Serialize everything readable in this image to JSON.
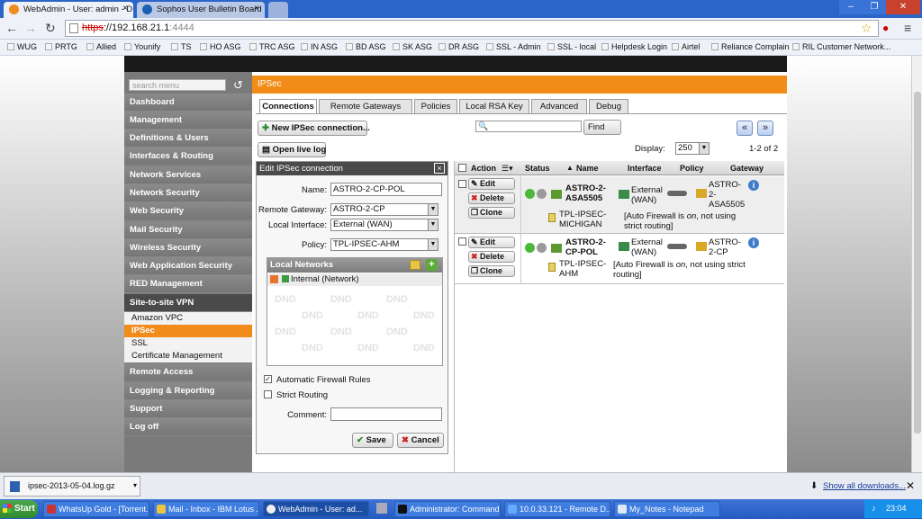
{
  "browser": {
    "tabs": [
      {
        "label": "WebAdmin - User: admin - D"
      },
      {
        "label": "Sophos User Bulletin Board"
      }
    ],
    "address": {
      "scheme": "https",
      "host": "://192.168.21.1",
      "port": ":4444"
    },
    "bookmarks": [
      "WUG",
      "PRTG",
      "Allied",
      "Younify",
      "TS",
      "HO ASG",
      "TRC ASG",
      "IN ASG",
      "BD ASG",
      "SK ASG",
      "DR ASG",
      "SSL - Admin",
      "SSL - local",
      "Helpdesk Login",
      "Airtel",
      "Reliance Complain",
      "RIL Customer Network..."
    ]
  },
  "sidebar": {
    "search_placeholder": "search menu",
    "items": [
      {
        "label": "Dashboard"
      },
      {
        "label": "Management"
      },
      {
        "label": "Definitions & Users"
      },
      {
        "label": "Interfaces & Routing"
      },
      {
        "label": "Network Services"
      },
      {
        "label": "Network Security"
      },
      {
        "label": "Web Security"
      },
      {
        "label": "Mail Security"
      },
      {
        "label": "Wireless Security"
      },
      {
        "label": "Web Application Security"
      },
      {
        "label": "RED Management"
      },
      {
        "label": "Site-to-site VPN"
      }
    ],
    "subitems": [
      {
        "label": "Amazon VPC"
      },
      {
        "label": "IPSec"
      },
      {
        "label": "SSL"
      },
      {
        "label": "Certificate Management"
      }
    ],
    "items_after": [
      {
        "label": "Remote Access"
      },
      {
        "label": "Logging & Reporting"
      },
      {
        "label": "Support"
      },
      {
        "label": "Log off"
      }
    ]
  },
  "page": {
    "section_title": "IPSec",
    "tabs": [
      "Connections",
      "Remote Gateways",
      "Policies",
      "Local RSA Key",
      "Advanced",
      "Debug"
    ],
    "new_button": "New IPSec connection...",
    "live_log_button": "Open live log",
    "find_button": "Find",
    "display_label": "Display:",
    "display_value": "250",
    "count": "1-2 of 2"
  },
  "edit": {
    "title": "Edit IPSec connection",
    "name_label": "Name:",
    "name_value": "ASTRO-2-CP-POL",
    "gateway_label": "Remote Gateway:",
    "gateway_value": "ASTRO-2-CP",
    "interface_label": "Local Interface:",
    "interface_value": "External (WAN)",
    "policy_label": "Policy:",
    "policy_value": "TPL-IPSEC-AHM",
    "local_networks_label": "Local Networks",
    "local_network_item": "Internal (Network)",
    "watermark": "DND",
    "auto_fw_label": "Automatic Firewall Rules",
    "strict_label": "Strict Routing",
    "comment_label": "Comment:",
    "save_label": "Save",
    "cancel_label": "Cancel"
  },
  "list": {
    "headers": {
      "action": "Action",
      "status": "Status",
      "name": "Name",
      "interface": "Interface",
      "policy": "Policy",
      "gateway": "Gateway"
    },
    "edit_label": "Edit",
    "delete_label": "Delete",
    "clone_label": "Clone",
    "rows": [
      {
        "name": "ASTRO-2-ASA5505",
        "interface": "External (WAN)",
        "gateway": "ASTRO-2-ASA5505",
        "policy": "TPL-IPSEC-MICHIGAN",
        "note_pre": "[Auto Firewall is ",
        "note_on": "on",
        "note_post": ", not using strict routing]"
      },
      {
        "name": "ASTRO-2-CP-POL",
        "interface": "External (WAN)",
        "gateway": "ASTRO-2-CP",
        "policy": "TPL-IPSEC-AHM",
        "note_pre": "[Auto Firewall is ",
        "note_on": "on",
        "note_post": ", not using strict routing]"
      }
    ]
  },
  "downloads": {
    "file": "ipsec-2013-05-04.log.gz",
    "show_all": "Show all downloads..."
  },
  "taskbar": {
    "start": "Start",
    "items": [
      "WhatsUp Gold - [Torrent...",
      "Mail - Inbox - IBM Lotus ...",
      "WebAdmin - User: ad...",
      "Administrator: Command...",
      "10.0.33.121 - Remote D...",
      "My_Notes - Notepad"
    ],
    "clock": "23:04"
  }
}
